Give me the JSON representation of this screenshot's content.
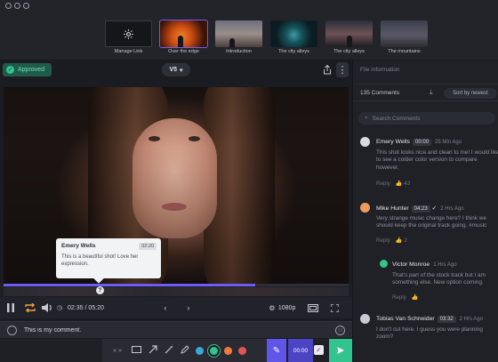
{
  "window": {
    "controls": [
      "close",
      "minimize",
      "maximize"
    ]
  },
  "thumbnails": [
    {
      "caption": "Manage Link",
      "icon": "gear-icon"
    },
    {
      "caption": "Over the edge",
      "active": true
    },
    {
      "caption": "Introduction"
    },
    {
      "caption": "The city alleys"
    },
    {
      "caption": "The city alleys"
    },
    {
      "caption": "The mountains"
    }
  ],
  "status": {
    "label": "Approved",
    "color": "#33c38f"
  },
  "version": {
    "label": "V5",
    "chevron": "▾"
  },
  "popup": {
    "name": "Emery Wells",
    "time": "02:20",
    "text": "This is a beautiful shot! Love her expression."
  },
  "timeline": {
    "progress": 0.73,
    "marker": "?"
  },
  "player": {
    "timecode": "02:35 / 05:20",
    "quality": "1080p",
    "icons": [
      "pause-icon",
      "loop-icon",
      "volume-icon",
      "prev-frame-icon",
      "next-frame-icon",
      "gear-icon",
      "fullscreen-icon",
      "expand-icon"
    ]
  },
  "comment_input": {
    "value": "This is my comment.",
    "placeholder": ""
  },
  "drawbar": {
    "nav": "« »",
    "colors": [
      "#3aa7d8",
      "#33c38f",
      "#f07a3a",
      "#e25555"
    ],
    "selected_color": 1,
    "time_chip": "00:00"
  },
  "panel": {
    "tab": "File information",
    "count": "135 Comments",
    "sort": "Sort by newest",
    "search_placeholder": "Search Comments",
    "reply_label": "Reply",
    "comments": [
      {
        "name": "Emery Wells",
        "tc": "00:00",
        "ago": "25 Min Ago",
        "text": "This shot looks nice and clean to me! I would like to see a colder color version to compare however.",
        "likes": "43",
        "avatar": "#d9d9de"
      },
      {
        "name": "Mike Hunter",
        "tc": "04:23",
        "ago": "2 Hrs Ago",
        "text": "Very strange music change here? I think we should keep the original track going. #music",
        "likes": "2",
        "avatar": "#f09a5c"
      },
      {
        "name": "Victor Monroe",
        "tc": "",
        "ago": "1 Hrs Ago",
        "text": "That's part of the stock track but I am something else. New option coming.",
        "likes": "",
        "avatar": "#33c38f"
      },
      {
        "name": "Tobias Van Schneider",
        "tc": "03:32",
        "ago": "2 Hrs Ago",
        "text": "I don't cut here. I guess you were planning zoom?",
        "likes": "",
        "avatar": "#c9cbd3"
      }
    ]
  }
}
